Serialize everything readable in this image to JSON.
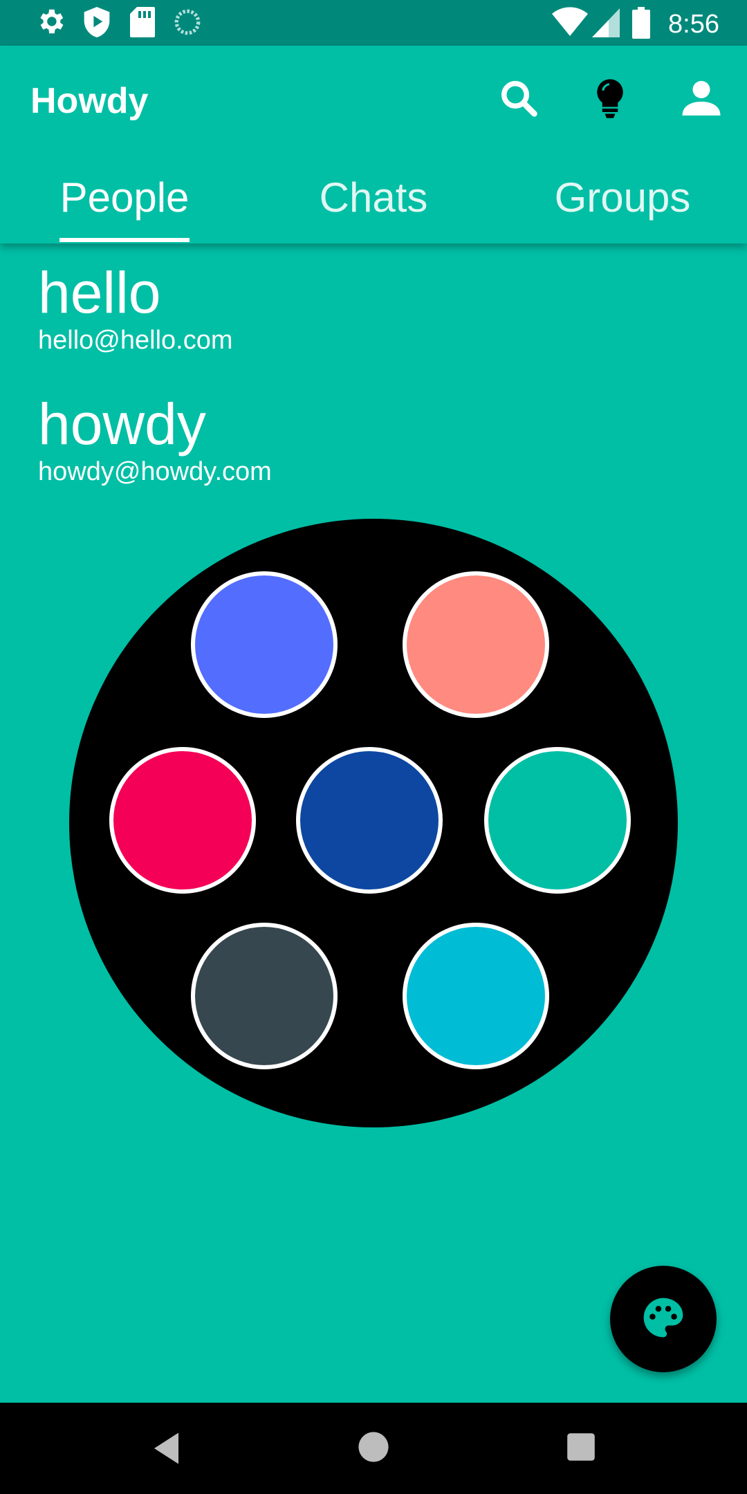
{
  "status_bar": {
    "time": "8:56",
    "left_icons": [
      "settings-icon",
      "play-protect-icon",
      "sd-card-icon",
      "sync-icon"
    ],
    "right_icons": [
      "wifi-icon",
      "cell-signal-icon",
      "battery-icon"
    ]
  },
  "app_bar": {
    "title": "Howdy",
    "actions": [
      "search-icon",
      "lightbulb-icon",
      "account-icon"
    ]
  },
  "tabs": [
    {
      "label": "People",
      "selected": true
    },
    {
      "label": "Chats",
      "selected": false
    },
    {
      "label": "Groups",
      "selected": false
    }
  ],
  "people": [
    {
      "name": "hello",
      "email": "hello@hello.com"
    },
    {
      "name": "howdy",
      "email": "howdy@howdy.com"
    }
  ],
  "palette": {
    "colors": [
      "#536DFE",
      "#FF8A80",
      "#F50057",
      "#0D47A1",
      "#00BFA5",
      "#37474F",
      "#00BCD4"
    ]
  },
  "fab": {
    "icon": "palette-icon"
  },
  "nav_bar": {
    "buttons": [
      "back-icon",
      "home-icon",
      "recents-icon"
    ]
  },
  "colors": {
    "primary": "#00BFA5",
    "status_bar": "#00897B",
    "accent": "#000000"
  }
}
